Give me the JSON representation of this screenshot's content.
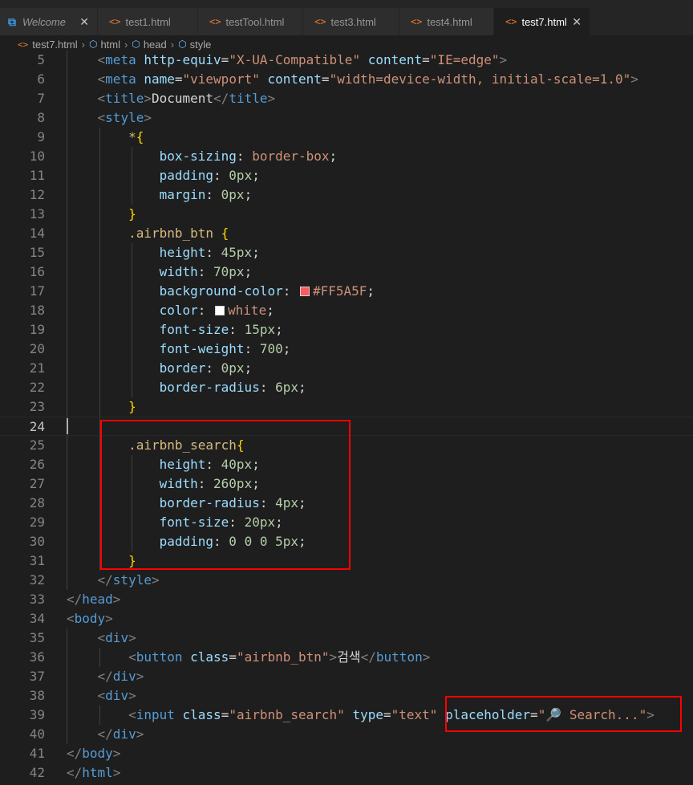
{
  "tabs": [
    {
      "label": "Welcome",
      "icon": "vscode-icon",
      "active": false
    },
    {
      "label": "test1.html",
      "icon": "html-file-icon",
      "active": false
    },
    {
      "label": "testTool.html",
      "icon": "html-file-icon",
      "active": false
    },
    {
      "label": "test3.html",
      "icon": "html-file-icon",
      "active": false
    },
    {
      "label": "test4.html",
      "icon": "html-file-icon",
      "active": false
    },
    {
      "label": "test7.html",
      "icon": "html-file-icon",
      "active": true
    }
  ],
  "breadcrumb": [
    "test7.html",
    "html",
    "head",
    "style"
  ],
  "editor": {
    "current_line": 24,
    "lines": [
      {
        "n": "5"
      },
      {
        "n": "6"
      },
      {
        "n": "7"
      },
      {
        "n": "8"
      },
      {
        "n": "9"
      },
      {
        "n": "10"
      },
      {
        "n": "11"
      },
      {
        "n": "12"
      },
      {
        "n": "13"
      },
      {
        "n": "14"
      },
      {
        "n": "15"
      },
      {
        "n": "16"
      },
      {
        "n": "17"
      },
      {
        "n": "18"
      },
      {
        "n": "19"
      },
      {
        "n": "20"
      },
      {
        "n": "21"
      },
      {
        "n": "22"
      },
      {
        "n": "23"
      },
      {
        "n": "24"
      },
      {
        "n": "25"
      },
      {
        "n": "26"
      },
      {
        "n": "27"
      },
      {
        "n": "28"
      },
      {
        "n": "29"
      },
      {
        "n": "30"
      },
      {
        "n": "31"
      },
      {
        "n": "32"
      },
      {
        "n": "33"
      },
      {
        "n": "34"
      },
      {
        "n": "35"
      },
      {
        "n": "36"
      },
      {
        "n": "37"
      },
      {
        "n": "38"
      },
      {
        "n": "39"
      },
      {
        "n": "40"
      },
      {
        "n": "41"
      },
      {
        "n": "42"
      }
    ]
  },
  "code": {
    "l5": {
      "tag": "meta",
      "a1": "http-equiv",
      "v1": "\"X-UA-Compatible\"",
      "a2": "content",
      "v2": "\"IE=edge\""
    },
    "l6": {
      "tag": "meta",
      "a1": "name",
      "v1": "\"viewport\"",
      "a2": "content",
      "v2": "\"width=device-width, initial-scale=1.0\""
    },
    "l7": {
      "tag": "title",
      "text": "Document"
    },
    "l8": {
      "tag": "style"
    },
    "l9": {
      "sel": "*"
    },
    "l10": {
      "prop": "box-sizing",
      "val": "border-box"
    },
    "l11": {
      "prop": "padding",
      "val": "0px"
    },
    "l12": {
      "prop": "margin",
      "val": "0px"
    },
    "l14": {
      "sel": ".airbnb_btn "
    },
    "l15": {
      "prop": "height",
      "val": "45px"
    },
    "l16": {
      "prop": "width",
      "val": "70px"
    },
    "l17": {
      "prop": "background-color",
      "val": "#FF5A5F",
      "swatch": "#FF5A5F"
    },
    "l18": {
      "prop": "color",
      "val": "white",
      "swatch": "#FFFFFF"
    },
    "l19": {
      "prop": "font-size",
      "val": "15px"
    },
    "l20": {
      "prop": "font-weight",
      "val": "700"
    },
    "l21": {
      "prop": "border",
      "val": "0px"
    },
    "l22": {
      "prop": "border-radius",
      "val": "6px"
    },
    "l25": {
      "sel": ".airbnb_search"
    },
    "l26": {
      "prop": "height",
      "val": "40px"
    },
    "l27": {
      "prop": "width",
      "val": "260px"
    },
    "l28": {
      "prop": "border-radius",
      "val": "4px"
    },
    "l29": {
      "prop": "font-size",
      "val": "20px"
    },
    "l30": {
      "prop": "padding",
      "val": "0 0 0 5px"
    },
    "l33": {
      "tag": "head"
    },
    "l34": {
      "tag": "body"
    },
    "l35": {
      "tag": "div"
    },
    "l36": {
      "tag": "button",
      "a1": "class",
      "v1": "\"airbnb_btn\"",
      "text": "검색"
    },
    "l38": {
      "tag": "div"
    },
    "l39": {
      "tag": "input",
      "a1": "class",
      "v1": "\"airbnb_search\"",
      "a2": "type",
      "v2": "\"text\"",
      "a3": "placeholder",
      "v3": "\"🔎 Search...\""
    },
    "l41": {
      "tag": "body"
    },
    "l42": {
      "tag": "html"
    }
  },
  "colors": {
    "highlight_box": "#FF0000",
    "swatch_red": "#FF5A5F",
    "swatch_white": "#FFFFFF"
  }
}
